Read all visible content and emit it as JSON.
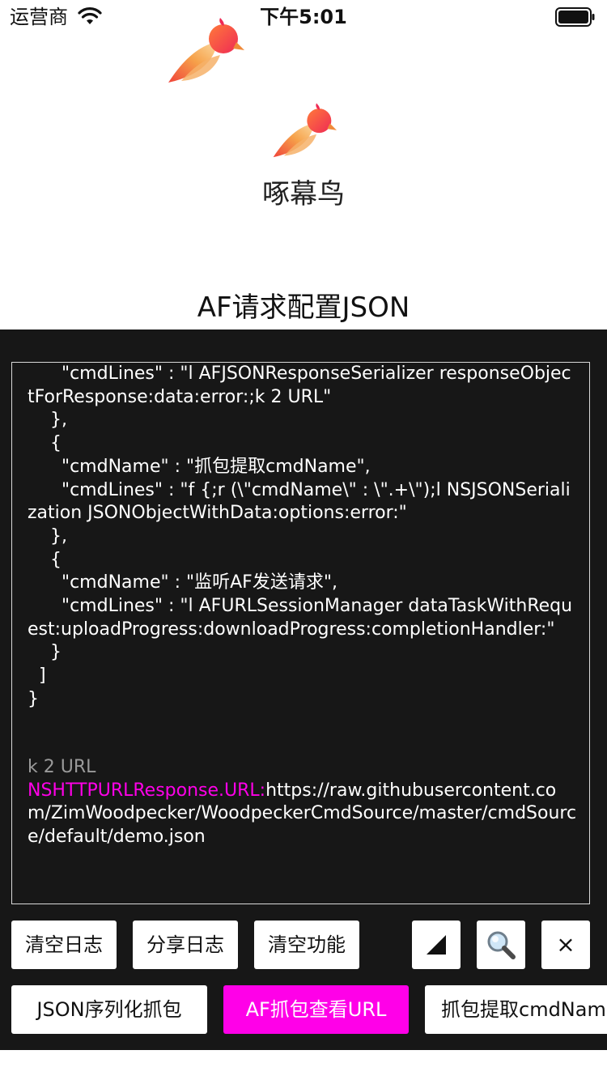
{
  "status_bar": {
    "carrier": "运营商",
    "time": "下午5:01"
  },
  "header": {
    "app_name": "啄幕鸟",
    "section_title": "AF请求配置JSON"
  },
  "log": {
    "text": "      \"cmdLines\" : \"l AFJSONResponseSerializer responseObjectForResponse:data:error:;k 2 URL\"\n    },\n    {\n      \"cmdName\" : \"抓包提取cmdName\",\n      \"cmdLines\" : \"f {;r (\\\"cmdName\\\" : \\\".+\\\");l NSJSONSerialization JSONObjectWithData:options:error:\"\n    },\n    {\n      \"cmdName\" : \"监听AF发送请求\",\n      \"cmdLines\" : \"l AFURLSessionManager dataTaskWithRequest:uploadProgress:downloadProgress:completionHandler:\"\n    }\n  ]\n}",
    "footer_cmd": "k 2 URL",
    "footer_label": "NSHTTPURLResponse.URL:",
    "footer_url": "https://raw.githubusercontent.com/ZimWoodpecker/WoodpeckerCmdSource/master/cmdSource/default/demo.json"
  },
  "toolbar": {
    "clear_log": "清空日志",
    "share_log": "分享日志",
    "clear_functions": "清空功能",
    "resize_icon": "resize-corner-icon",
    "search_icon": "magnifier-icon",
    "close_icon": "close-icon",
    "close_glyph": "×"
  },
  "functions": {
    "json_capture": "JSON序列化抓包",
    "af_view_url": "AF抓包查看URL",
    "extract_cmdname": "抓包提取cmdName"
  },
  "colors": {
    "panel_bg": "#171717",
    "accent_magenta": "#ff00e8",
    "bird_red": "#f0433a",
    "bird_orange": "#f6a24a"
  }
}
